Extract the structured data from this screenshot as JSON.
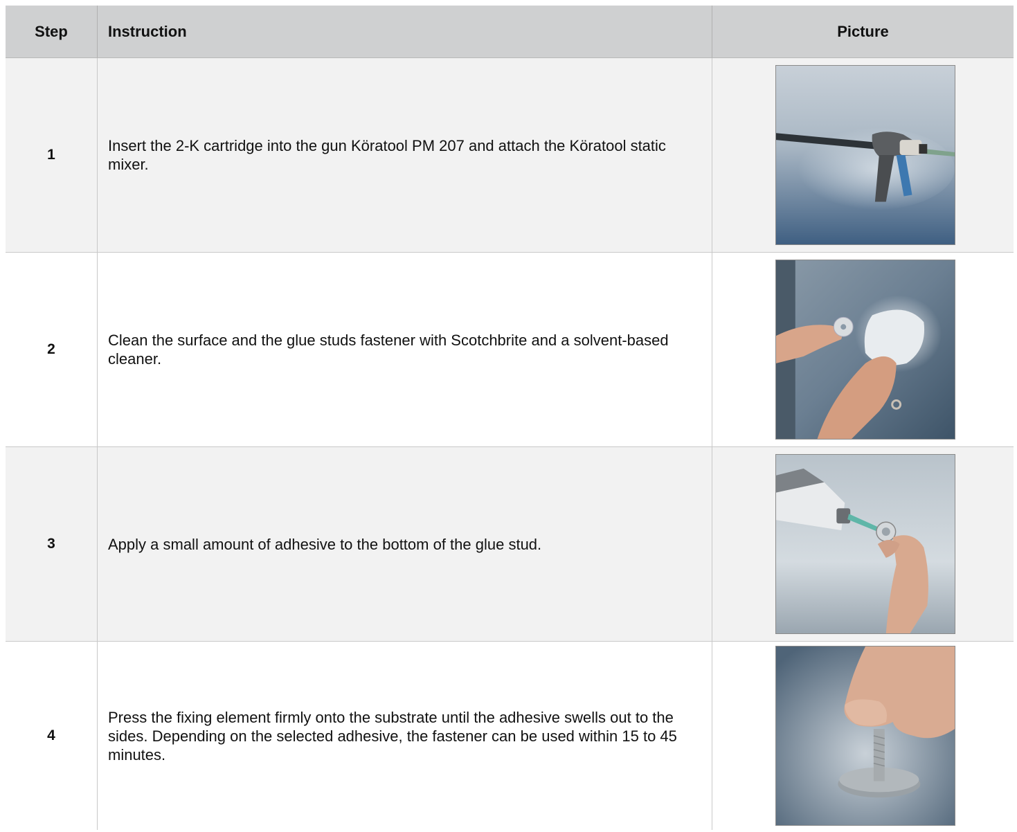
{
  "table": {
    "headers": {
      "step": "Step",
      "instruction": "Instruction",
      "picture": "Picture"
    },
    "rows": [
      {
        "step": "1",
        "instruction": "Insert the 2-K cartridge into the gun Köratool PM 207 and attach the Köratool static mixer.",
        "picture_icon": "cartridge-gun-photo"
      },
      {
        "step": "2",
        "instruction": "Clean the surface and the glue studs fastener with Scotchbrite and a solvent-based cleaner.",
        "picture_icon": "cleaning-surface-photo"
      },
      {
        "step": "3",
        "instruction": "Apply a small amount of adhesive to the bottom of the glue stud.",
        "picture_icon": "applying-adhesive-photo"
      },
      {
        "step": "4",
        "instruction": "Press the fixing element firmly onto the substrate until the adhesive swells out to the sides. Depending on the selected adhesive, the fastener can be used within 15 to 45 minutes.",
        "picture_icon": "pressing-fastener-photo"
      }
    ]
  },
  "colors": {
    "header_bg": "#cfd0d1",
    "row_shaded": "#f2f2f2",
    "row_plain": "#ffffff",
    "grid_line": "#c8c8c8"
  }
}
